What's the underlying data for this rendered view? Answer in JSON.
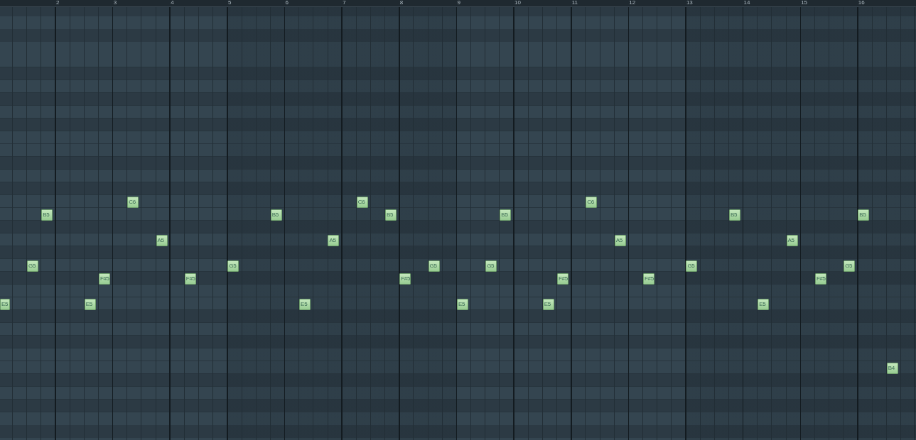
{
  "ruler": {
    "bar_numbers": [
      "2",
      "3",
      "4",
      "5",
      "6",
      "7",
      "8",
      "9",
      "10",
      "11",
      "12",
      "13",
      "14",
      "15",
      "16"
    ]
  },
  "notes": [
    {
      "label": "E5"
    },
    {
      "label": "G5"
    },
    {
      "label": "B5"
    },
    {
      "label": "E5"
    },
    {
      "label": "F#5"
    },
    {
      "label": "C6"
    },
    {
      "label": "A5"
    },
    {
      "label": "F#5"
    },
    {
      "label": "G5"
    },
    {
      "label": "B5"
    },
    {
      "label": "E5"
    },
    {
      "label": "A5"
    },
    {
      "label": "C6"
    },
    {
      "label": "B5"
    },
    {
      "label": "F#5"
    },
    {
      "label": "G5"
    },
    {
      "label": "E5"
    },
    {
      "label": "G5"
    },
    {
      "label": "B5"
    },
    {
      "label": "E5"
    },
    {
      "label": "F#5"
    },
    {
      "label": "C6"
    },
    {
      "label": "A5"
    },
    {
      "label": "F#5"
    },
    {
      "label": "G5"
    },
    {
      "label": "B5"
    },
    {
      "label": "E5"
    },
    {
      "label": "A5"
    },
    {
      "label": "F#5"
    },
    {
      "label": "G5"
    },
    {
      "label": "B5"
    },
    {
      "label": "B4"
    }
  ]
}
